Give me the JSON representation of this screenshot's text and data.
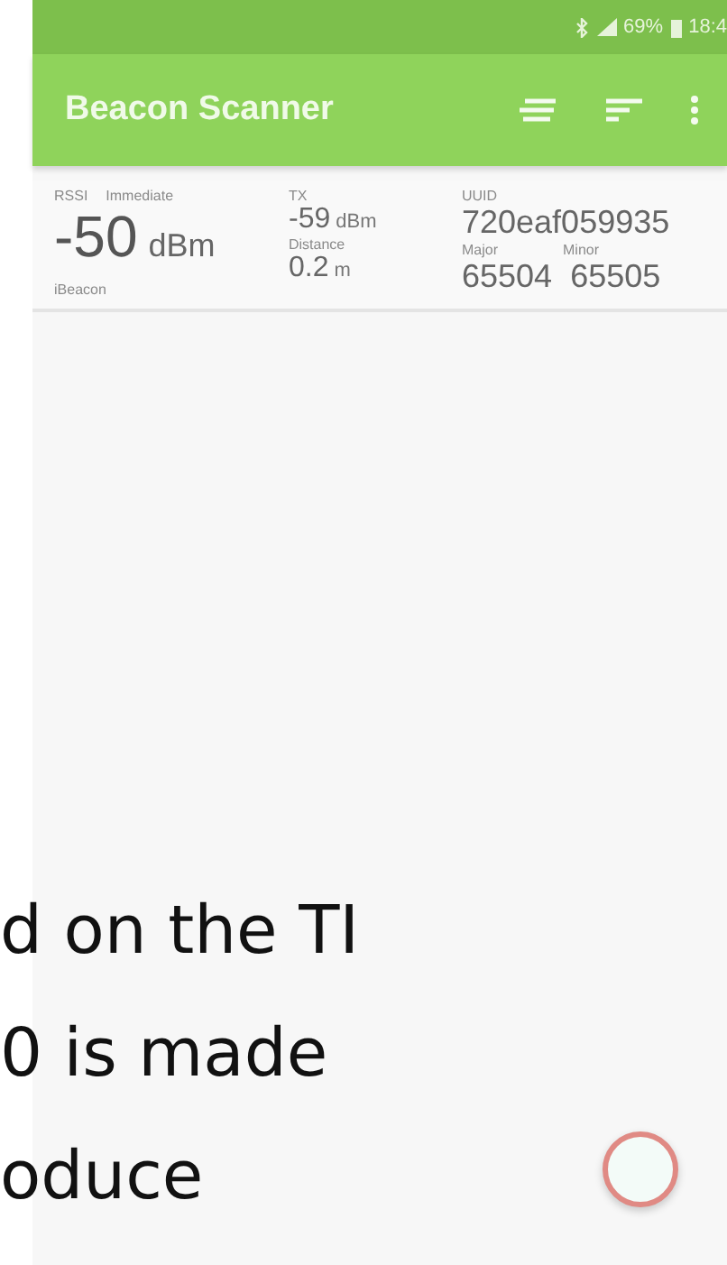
{
  "status_bar": {
    "battery": "69%",
    "time": "18:4"
  },
  "app_bar": {
    "title": "Beacon Scanner"
  },
  "beacon": {
    "rssi_label": "RSSI",
    "proximity": "Immediate",
    "rssi_value": "-50",
    "rssi_unit": "dBm",
    "type": "iBeacon",
    "tx_label": "TX",
    "tx_value": "-59",
    "tx_unit": "dBm",
    "distance_label": "Distance",
    "distance_value": "0.2",
    "distance_unit": "m",
    "uuid_label": "UUID",
    "uuid": "720eaf059935",
    "major_label": "Major",
    "major": "65504",
    "minor_label": "Minor",
    "minor": "65505"
  },
  "overlay_text": [
    "d on the TI",
    "0 is made",
    "oduce"
  ]
}
